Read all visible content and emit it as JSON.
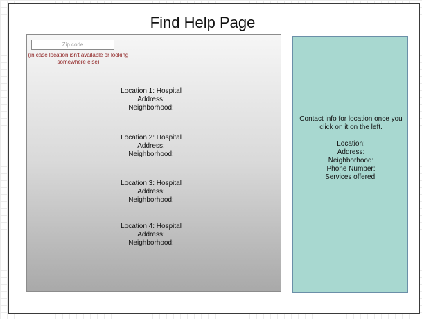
{
  "page": {
    "title": "Find Help Page"
  },
  "search": {
    "zip_placeholder": "Zip code",
    "zip_value": "",
    "note": "(in case location isn't available or looking somewhere else)"
  },
  "locations": [
    {
      "title": "Location 1: Hospital",
      "address_label": "Address:",
      "neighborhood_label": "Neighborhood:"
    },
    {
      "title": "Location 2: Hospital",
      "address_label": "Address:",
      "neighborhood_label": "Neighborhood:"
    },
    {
      "title": "Location 3: Hospital",
      "address_label": "Address:",
      "neighborhood_label": "Neighborhood:"
    },
    {
      "title": "Location 4: Hospital",
      "address_label": "Address:",
      "neighborhood_label": "Neighborhood:"
    }
  ],
  "contact_panel": {
    "intro": "Contact info for location once you click on it on the left.",
    "fields": {
      "location": "Location:",
      "address": "Address:",
      "neighborhood": "Neighborhood:",
      "phone": "Phone Number:",
      "services": "Services offered:"
    }
  },
  "colors": {
    "contact_panel_bg": "#a8d8d0",
    "note_text": "#8b1a1a"
  }
}
